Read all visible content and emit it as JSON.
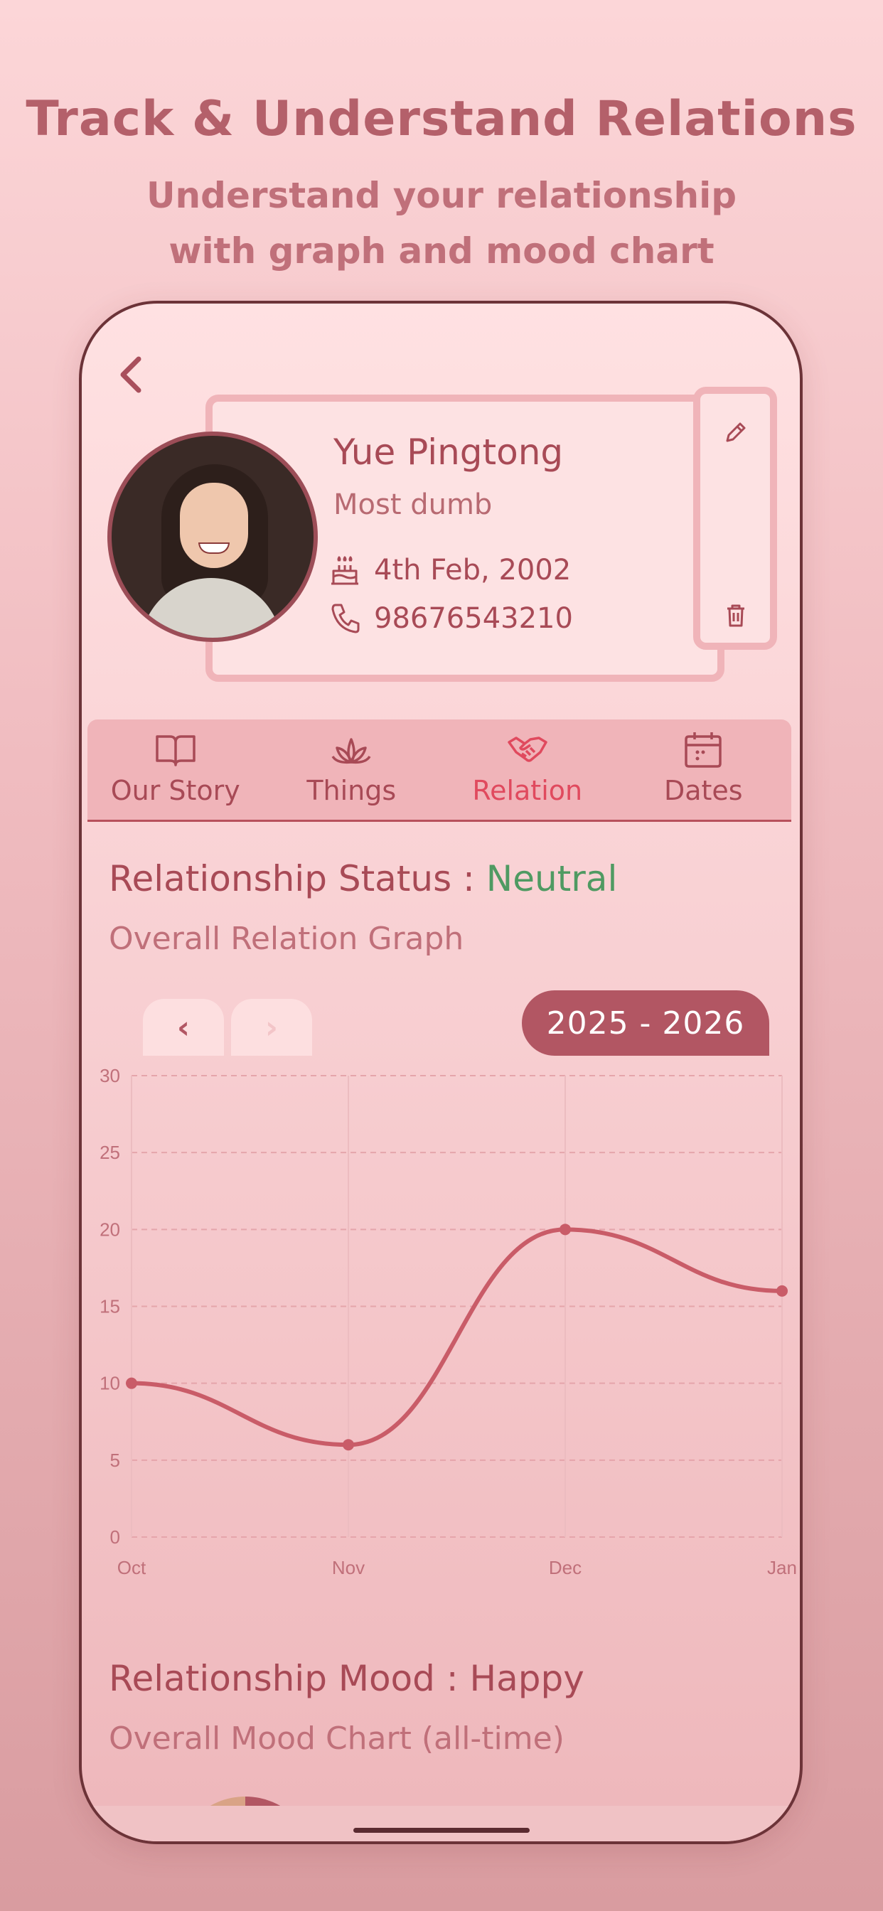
{
  "headline": "Track & Understand Relations",
  "subheadline": "Understand your relationship with graph and mood chart",
  "profile": {
    "name": "Yue Pingtong",
    "nickname": "Most dumb",
    "birthday": "4th Feb, 2002",
    "phone": "98676543210"
  },
  "icons": {
    "back": "chevron-left-icon",
    "edit": "pencil-icon",
    "delete": "trash-icon",
    "birthday": "cake-icon",
    "phone": "phone-icon"
  },
  "tabs": [
    {
      "label": "Our Story",
      "icon": "book-icon"
    },
    {
      "label": "Things",
      "icon": "lotus-icon"
    },
    {
      "label": "Relation",
      "icon": "handshake-icon",
      "active": true
    },
    {
      "label": "Dates",
      "icon": "calendar-icon"
    }
  ],
  "status": {
    "label": "Relationship Status : ",
    "value": "Neutral",
    "graph_title": "Overall Relation Graph"
  },
  "graph_nav": {
    "prev": "‹",
    "next": "›",
    "year_range": "2025 - 2026"
  },
  "chart_data": {
    "type": "line",
    "x": [
      "Oct",
      "Nov",
      "Dec",
      "Jan"
    ],
    "series": [
      {
        "values": [
          10,
          6,
          20,
          16
        ]
      }
    ],
    "ylim": [
      0,
      30
    ],
    "yticks": [
      0,
      5,
      10,
      15,
      20,
      25,
      30
    ],
    "grid": true,
    "smooth": true,
    "color": "#c95c68"
  },
  "mood": {
    "label": "Relationship Mood : ",
    "value": "Happy",
    "chart_title": "Overall Mood Chart (all-time)"
  },
  "colors": {
    "accent": "#b25663",
    "active_tab": "#e04a5e",
    "neutral": "#4f9a62"
  }
}
